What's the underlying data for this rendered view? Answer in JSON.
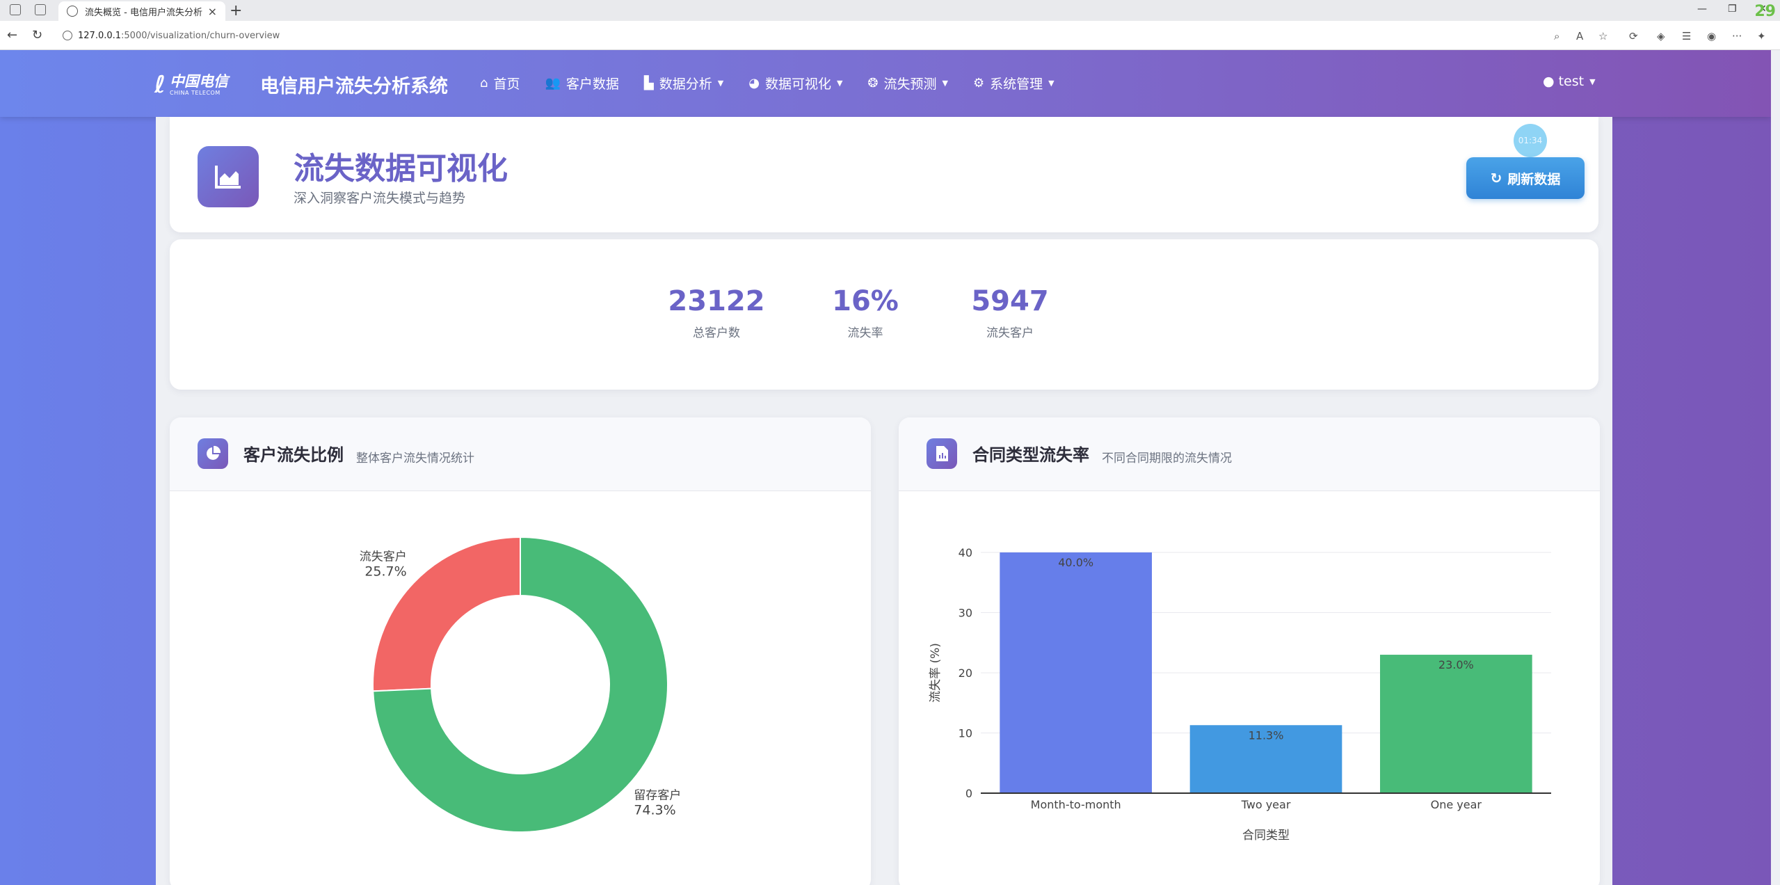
{
  "browser": {
    "tab_title": "流失概览 - 电信用户流失分析系统",
    "url_host": "127.0.0.1",
    "url_path": ":5000/visualization/churn-overview",
    "corner_badge": "29"
  },
  "navbar": {
    "logo_cn": "中国电信",
    "logo_en": "CHINA TELECOM",
    "brand": "电信用户流失分析系统",
    "menu": [
      {
        "label": "首页",
        "icon": "home-icon",
        "dropdown": false
      },
      {
        "label": "客户数据",
        "icon": "users-icon",
        "dropdown": false
      },
      {
        "label": "数据分析",
        "icon": "chart-icon",
        "dropdown": true
      },
      {
        "label": "数据可视化",
        "icon": "pie-icon",
        "dropdown": true
      },
      {
        "label": "流失预测",
        "icon": "brain-icon",
        "dropdown": true
      },
      {
        "label": "系统管理",
        "icon": "cog-icon",
        "dropdown": true
      }
    ],
    "user": "test"
  },
  "header": {
    "title": "流失数据可视化",
    "subtitle": "深入洞察客户流失模式与趋势",
    "refresh_label": "刷新数据",
    "timer": "01:34"
  },
  "stats": [
    {
      "value": "23122",
      "label": "总客户数"
    },
    {
      "value": "16%",
      "label": "流失率"
    },
    {
      "value": "5947",
      "label": "流失客户"
    }
  ],
  "charts": {
    "pie_card": {
      "title": "客户流失比例",
      "subtitle": "整体客户流失情况统计"
    },
    "bar_card": {
      "title": "合同类型流失率",
      "subtitle": "不同合同期限的流失情况"
    }
  },
  "chart_data": [
    {
      "type": "pie",
      "title": "",
      "labels": [
        "流失客户",
        "留存客户"
      ],
      "values": [
        25.7,
        74.3
      ],
      "value_labels": [
        "25.7%",
        "74.3%"
      ],
      "colors": [
        "#f26665",
        "#48bb78"
      ],
      "hole": true
    },
    {
      "type": "bar",
      "title": "",
      "categories": [
        "Month-to-month",
        "Two year",
        "One year"
      ],
      "values": [
        40.0,
        11.3,
        23.0
      ],
      "value_labels": [
        "40.0%",
        "11.3%",
        "23.0%"
      ],
      "colors": [
        "#667eea",
        "#4299e1",
        "#48bb78"
      ],
      "xlabel": "合同类型",
      "ylabel": "流失率 (%)",
      "yticks": [
        0,
        10,
        20,
        30,
        40
      ],
      "ylim": [
        0,
        40
      ],
      "grid": true
    }
  ]
}
